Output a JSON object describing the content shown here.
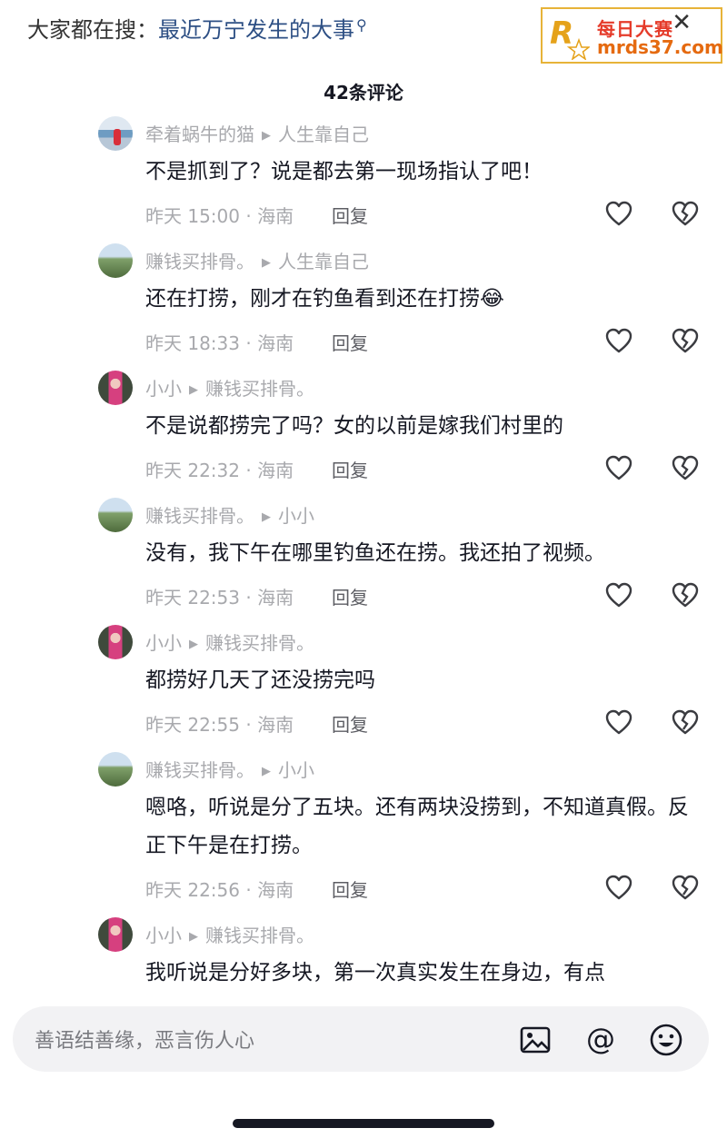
{
  "search": {
    "prefix": "大家都在搜：",
    "query": "最近万宁发生的大事"
  },
  "ad": {
    "brand": "每日大赛",
    "site": "mrds37.com"
  },
  "comment_count": "42条评论",
  "comments": [
    {
      "user": "牵着蜗牛的猫",
      "reply_to": "人生靠自己",
      "text": "不是抓到了？说是都去第一现场指认了吧！",
      "info": "昨天 15:00 · 海南",
      "reply": "回复",
      "avatar": "sea"
    },
    {
      "user": "赚钱买排骨。",
      "reply_to": "人生靠自己",
      "text": "还在打捞，刚才在钓鱼看到还在打捞😂",
      "info": "昨天 18:33 · 海南",
      "reply": "回复",
      "avatar": "green"
    },
    {
      "user": "小小",
      "reply_to": "赚钱买排骨。",
      "text": "不是说都捞完了吗？女的以前是嫁我们村里的",
      "info": "昨天 22:32 · 海南",
      "reply": "回复",
      "avatar": "pink"
    },
    {
      "user": "赚钱买排骨。",
      "reply_to": "小小",
      "text": "没有，我下午在哪里钓鱼还在捞。我还拍了视频。",
      "info": "昨天 22:53 · 海南",
      "reply": "回复",
      "avatar": "green"
    },
    {
      "user": "小小",
      "reply_to": "赚钱买排骨。",
      "text": "都捞好几天了还没捞完吗",
      "info": "昨天 22:55 · 海南",
      "reply": "回复",
      "avatar": "pink"
    },
    {
      "user": "赚钱买排骨。",
      "reply_to": "小小",
      "text": "嗯咯，听说是分了五块。还有两块没捞到，不知道真假。反正下午是在打捞。",
      "info": "昨天 22:56 · 海南",
      "reply": "回复",
      "avatar": "green"
    },
    {
      "user": "小小",
      "reply_to": "赚钱买排骨。",
      "text": "我听说是分好多块，第一次真实发生在身边，有点",
      "avatar": "pink"
    }
  ],
  "input": {
    "placeholder": "善语结善缘，恶言伤人心"
  },
  "icons": {
    "image": "image-icon",
    "mention": "at-icon",
    "emoji": "emoji-icon",
    "like": "heart-icon",
    "dislike": "broken-heart-icon",
    "close": "close-icon"
  }
}
